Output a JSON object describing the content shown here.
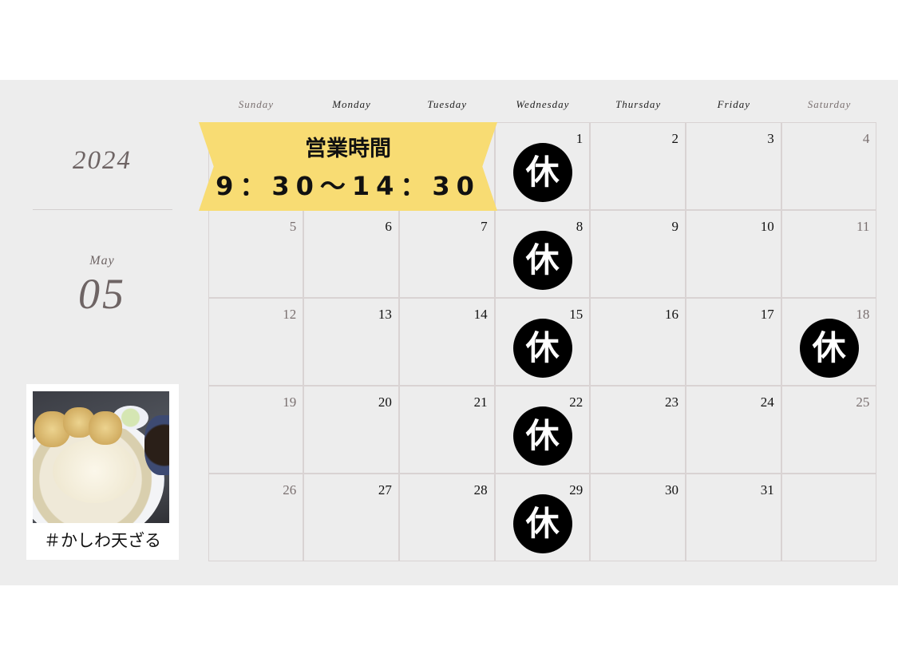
{
  "calendar": {
    "year": "2024",
    "month_name": "May",
    "month_number": "05",
    "weekdays": [
      "Sunday",
      "Monday",
      "Tuesday",
      "Wednesday",
      "Thursday",
      "Friday",
      "Saturday"
    ],
    "weeks": [
      [
        null,
        null,
        null,
        {
          "day": "1",
          "holiday": true
        },
        {
          "day": "2"
        },
        {
          "day": "3"
        },
        {
          "day": "4"
        }
      ],
      [
        {
          "day": "5"
        },
        {
          "day": "6"
        },
        {
          "day": "7"
        },
        {
          "day": "8",
          "holiday": true
        },
        {
          "day": "9"
        },
        {
          "day": "10"
        },
        {
          "day": "11"
        }
      ],
      [
        {
          "day": "12"
        },
        {
          "day": "13"
        },
        {
          "day": "14"
        },
        {
          "day": "15",
          "holiday": true
        },
        {
          "day": "16"
        },
        {
          "day": "17"
        },
        {
          "day": "18",
          "holiday": true
        }
      ],
      [
        {
          "day": "19"
        },
        {
          "day": "20"
        },
        {
          "day": "21"
        },
        {
          "day": "22",
          "holiday": true
        },
        {
          "day": "23"
        },
        {
          "day": "24"
        },
        {
          "day": "25"
        }
      ],
      [
        {
          "day": "26"
        },
        {
          "day": "27"
        },
        {
          "day": "28"
        },
        {
          "day": "29",
          "holiday": true
        },
        {
          "day": "30"
        },
        {
          "day": "31"
        },
        null
      ]
    ],
    "holiday_mark": "休"
  },
  "banner": {
    "title": "営業時間",
    "hours": "9：30〜14：30"
  },
  "photo": {
    "caption": "＃かしわ天ざる"
  },
  "colors": {
    "banner": "#f8dc73",
    "holiday_circle": "#000000",
    "background": "#ededed",
    "weekend_text": "#7a7070"
  }
}
